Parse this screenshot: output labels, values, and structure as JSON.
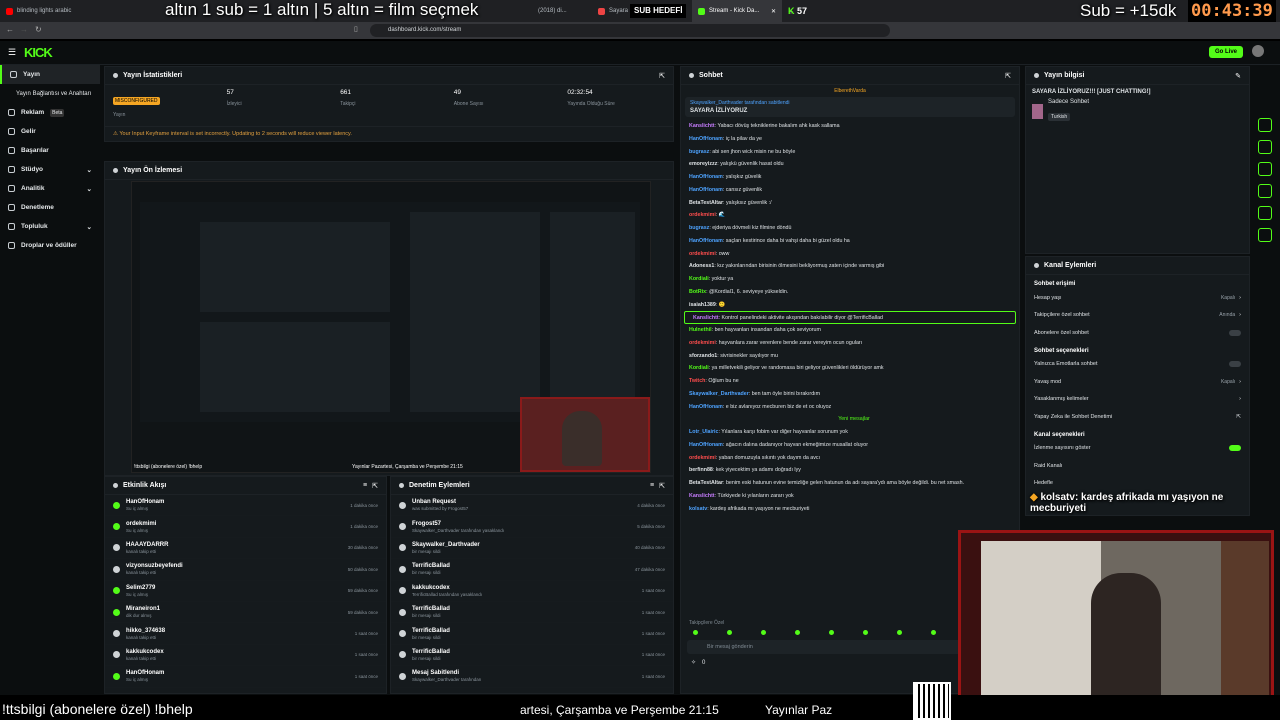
{
  "browser": {
    "tabs": [
      "blinding lights arabic",
      "(2018) di...",
      "Sayara İzliyoruz | dü...",
      "Stream - Kick Da..."
    ],
    "url": "dashboard.kick.com/stream"
  },
  "overlay": {
    "top_text": "altın   1 sub = 1 altın | 5 altın = film seçmek",
    "sub_hedefi": "SUB HEDEFİ",
    "sub_count": "57",
    "sub_goal": "Sub = +15dk",
    "timer": "00:43:39",
    "bottom_left": "!ttsbilgi (abonelere özel)   !bhelp",
    "bottom_mid": "artesi, Çarşamba ve Perşembe 21:15",
    "bottom_mid2": "Yayınlar Paz",
    "popup_user": "kolsatv",
    "popup_text": ": kardeş afrikada mı yaşıyon ne mecburiyeti"
  },
  "topbar": {
    "logo": "KICK",
    "go_live": "Go Live"
  },
  "sidebar": {
    "items": [
      {
        "label": "Yayın",
        "active": true
      },
      {
        "label": "Yayın Bağlantısı ve Anahtarı",
        "active": false
      },
      {
        "label": "Reklam",
        "badge": "Beta",
        "active": false
      },
      {
        "label": "Gelir",
        "active": false
      },
      {
        "label": "Başarılar",
        "active": false
      },
      {
        "label": "Stüdyo",
        "active": false
      },
      {
        "label": "Analitik",
        "active": false
      },
      {
        "label": "Denetleme",
        "active": false
      },
      {
        "label": "Topluluk",
        "active": false
      },
      {
        "label": "Droplar ve ödüller",
        "active": false
      }
    ]
  },
  "stats": {
    "title": "Yayın İstatistikleri",
    "items": [
      {
        "value": "MISCONFIGURED",
        "label": "Yayın"
      },
      {
        "value": "57",
        "label": "İzleyici"
      },
      {
        "value": "661",
        "label": "Takipçi"
      },
      {
        "value": "49",
        "label": "Abone Sayısı"
      },
      {
        "value": "02:32:54",
        "label": "Yayında Olduğu Süre"
      }
    ],
    "warning": "Your Input Keyframe interval is set incorrectly. Updating to 2 seconds will reduce viewer latency."
  },
  "preview": {
    "title": "Yayın Ön İzlemesi",
    "caption_left": "!ttsbilgi (abonelere özel)   !bhelp",
    "caption_right": "Yayınlar Pazartesi, Çarşamba ve Perşembe 21:15"
  },
  "activity": {
    "title": "Etkinlik Akışı",
    "items": [
      {
        "name": "HanOfHonam",
        "sub": "Su iç almış",
        "time": "1 dakika önce"
      },
      {
        "name": "ordekmimi",
        "sub": "Su iç almış",
        "time": "1 dakika önce"
      },
      {
        "name": "HAAAYDARRR",
        "sub": "kanalı takip etti",
        "time": "30 dakika önce"
      },
      {
        "name": "vizyonsuzbeyefendi",
        "sub": "kanalı takip etti",
        "time": "50 dakika önce"
      },
      {
        "name": "Selim2779",
        "sub": "Su iç almış",
        "time": "59 dakika önce"
      },
      {
        "name": "Miraneiron1",
        "sub": "dik dur almış",
        "time": "59 dakika önce"
      },
      {
        "name": "hikko_374638",
        "sub": "kanalı takip etti",
        "time": "1 saat önce"
      },
      {
        "name": "kakkukcodex",
        "sub": "kanalı takip etti",
        "time": "1 saat önce"
      },
      {
        "name": "HanOfHonam",
        "sub": "Su iç almış",
        "time": "1 saat önce"
      }
    ]
  },
  "moderation": {
    "title": "Denetim Eylemleri",
    "items": [
      {
        "name": "Unban Request",
        "sub": "was submitted by Frogost57",
        "time": "4 dakika önce"
      },
      {
        "name": "Frogost57",
        "sub": "Skaywalker_Darthvader tarafından yasaklandı",
        "time": "5 dakika önce"
      },
      {
        "name": "Skaywalker_Darthvader",
        "sub": "bir mesajı sildi",
        "time": "40 dakika önce"
      },
      {
        "name": "TerrificBallad",
        "sub": "bir mesajı sildi",
        "time": "47 dakika önce"
      },
      {
        "name": "kakkukcodex",
        "sub": "TerrificBallad tarafından yasaklandı",
        "time": "1 saat önce"
      },
      {
        "name": "TerrificBallad",
        "sub": "bir mesajı sildi",
        "time": "1 saat önce"
      },
      {
        "name": "TerrificBallad",
        "sub": "bir mesajı sildi",
        "time": "1 saat önce"
      },
      {
        "name": "TerrificBallad",
        "sub": "bir mesajı sildi",
        "time": "1 saat önce"
      },
      {
        "name": "Mesaj Sabitlendi",
        "sub": "Skaywalker_Darthvader tarafından",
        "time": "1 saat önce"
      }
    ]
  },
  "chat": {
    "title": "Sohbet",
    "top_user": "ElberethVarda",
    "pinned_by": "Skaywalker_Darthvader tarafından sabitlendi",
    "pinned_text": "SAYARA İZLİYORUZ",
    "new_messages": "Yeni mesajlar",
    "followers_only": "Takipçilere Özel",
    "input_placeholder": "Bir mesaj gönderin",
    "points": "0",
    "messages": [
      {
        "user": "Kanslichtt",
        "color": "#c77dff",
        "text": ": Yabacı dövüş tekniklerine bakalım ahk kask sallama"
      },
      {
        "user": "HanOfHonam",
        "color": "#4ea3ff",
        "text": ": iç la pilav da ye"
      },
      {
        "user": "bugrasz",
        "color": "#4ea3ff",
        "text": ": abi sen jhon wick misin ne bu böyle"
      },
      {
        "user": "emoreyizzz",
        "color": "#dfe3e6",
        "text": ": yalışkü güvenlik hasat oldu"
      },
      {
        "user": "HanOfHonam",
        "color": "#4ea3ff",
        "text": ": yalışkız güvelik"
      },
      {
        "user": "HanOfHonam",
        "color": "#4ea3ff",
        "text": ": cansız güvenlik"
      },
      {
        "user": "BetaTestAltar",
        "color": "#dfe3e6",
        "text": ": yalışksız güvenlik :/"
      },
      {
        "user": "ordekmimi",
        "color": "#ff4d4d",
        "text": ": 🌊"
      },
      {
        "user": "bugrasz",
        "color": "#4ea3ff",
        "text": ": ejderiya dövmeli kiz filmine döndü"
      },
      {
        "user": "HanOfHonam",
        "color": "#4ea3ff",
        "text": ": saçları kestirince daha bi vahşi daha bi güzel oldu ha"
      },
      {
        "user": "ordekmimi",
        "color": "#ff4d4d",
        "text": ": oww"
      },
      {
        "user": "Adoness1",
        "color": "#dfe3e6",
        "text": ": kız yakınlarından birisinin ölmesini bekliyormuş zaten içinde varmış gibi"
      },
      {
        "user": "Kordiali",
        "color": "#53fc18",
        "text": ": yoktur ya"
      },
      {
        "user": "BotRix",
        "color": "#53fc18",
        "text": ": @Kordial1, 6. seviyeye yükseldin."
      },
      {
        "user": "isaiah1389",
        "color": "#dfe3e6",
        "text": ": 🙂"
      },
      {
        "user": "Kanslichtt",
        "color": "#c77dff",
        "text": ": Kontrol panelindeki aktivite akışından bakılabilir diyor @TerrificBallad"
      },
      {
        "user": "Hulnethil",
        "color": "#53fc18",
        "text": ": ben hayvanları insandan daha çok seviyorum"
      },
      {
        "user": "ordekmimi",
        "color": "#ff4d4d",
        "text": ": hayvanlara zarar verenlere bende zarar vereyim ocun oguları"
      },
      {
        "user": "sforzando1",
        "color": "#dfe3e6",
        "text": ": sivrisinekler sayılıyor mu"
      },
      {
        "user": "Kordiali",
        "color": "#53fc18",
        "text": ": ya milletvekili geliyor ve randomasa biri geliyor güvenlikleri öldürüyor amk"
      },
      {
        "user": "Twitch",
        "color": "#ff4d4d",
        "text": ": Oğlum bu ne"
      },
      {
        "user": "Skaywalker_Darthvader",
        "color": "#4ea3ff",
        "text": ": ben tam öyle birini bırakırdım"
      },
      {
        "user": "HanOfHonam",
        "color": "#4ea3ff",
        "text": ": e biz avlanıyoz mecburen biz de et oc oluyoz"
      },
      {
        "user": "Lotr_Ulairic",
        "color": "#4ea3ff",
        "text": ": Yılanlara karşı fobim var diğer hayvanlar sorunum yok"
      },
      {
        "user": "HanOfHonam",
        "color": "#4ea3ff",
        "text": ": ağacın dalına dadanıyor hayvan ekmeğimize musallat oluyor"
      },
      {
        "user": "ordekmimi",
        "color": "#ff4d4d",
        "text": ": yaban domuzuyla sıkıntı yok dayım da avcı"
      },
      {
        "user": "berfinn88",
        "color": "#dfe3e6",
        "text": ": kek yiyecektim ya adamı doğradı lyy"
      },
      {
        "user": "BetaTestAltar",
        "color": "#dfe3e6",
        "text": ": benim eski hatunun evine temizliğe gelen hatunun da adı sayara'ydı ama böyle değildi. bu net smash."
      },
      {
        "user": "Kanslichtt",
        "color": "#c77dff",
        "text": ": Türkiyede ki yılanların zararı yok"
      },
      {
        "user": "kolsatv",
        "color": "#4ea3ff",
        "text": ": kardeş afrikada mı yaşıyon ne mecburiyeti"
      }
    ]
  },
  "stream_info": {
    "title": "Yayın bilgisi",
    "stream_title": "SAYARA İZLİYORUZ!!! [JUST CHATTING!]",
    "category": "Sadece Sohbet",
    "language": "Turkish"
  },
  "channel_actions": {
    "title": "Kanal Eylemleri",
    "chat_access": "Sohbet erişimi",
    "chat_options": "Sohbet seçenekleri",
    "channel_options": "Kanal seçenekleri",
    "rows": [
      {
        "label": "Hesap yaşı",
        "value": "Kapalı"
      },
      {
        "label": "Takipçilere özel sohbet",
        "value": "Anında"
      },
      {
        "label": "Abonelere özel sohbet",
        "value": ""
      },
      {
        "label": "Yalnızca Emotlarla sohbet",
        "value": ""
      },
      {
        "label": "Yavaş mod",
        "value": "Kapalı"
      },
      {
        "label": "Yasaklanmış kelimeler",
        "value": ""
      },
      {
        "label": "Yapay Zeka ile Sohbet Denetimi",
        "value": ""
      },
      {
        "label": "İzlenme sayısını göster",
        "value": ""
      },
      {
        "label": "Raid Kanalı",
        "value": ""
      },
      {
        "label": "Hedefle",
        "value": ""
      }
    ]
  },
  "colors": {
    "accent": "#53fc18",
    "panel": "#151a1d",
    "bg": "#0b0e0f",
    "timer": "#ff9a4d"
  }
}
